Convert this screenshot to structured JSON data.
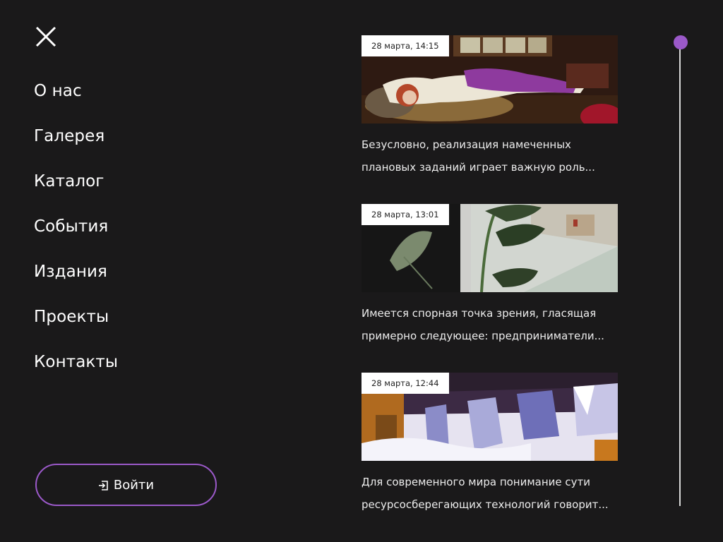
{
  "menu": {
    "close_icon": "close-icon",
    "items": [
      {
        "label": "О нас"
      },
      {
        "label": "Галерея"
      },
      {
        "label": "Каталог"
      },
      {
        "label": "События"
      },
      {
        "label": "Издания"
      },
      {
        "label": "Проекты"
      },
      {
        "label": "Контакты"
      }
    ],
    "login": {
      "label": "Войти",
      "icon": "sign-in-icon"
    }
  },
  "news": [
    {
      "date": "28 марта, 14:15",
      "excerpt": "Безусловно, реализация намеченных плановых заданий играет важную роль..."
    },
    {
      "date": "28 марта, 13:01",
      "excerpt": "Имеется спорная точка зрения, гласящая примерно следующее: предприниматели..."
    },
    {
      "date": "28 марта, 12:44",
      "excerpt": "Для современного мира понимание сути ресурсосберегающих технологий говорит..."
    }
  ],
  "colors": {
    "background": "#1a191a",
    "accent": "#9b59c9",
    "text": "#ffffff"
  }
}
